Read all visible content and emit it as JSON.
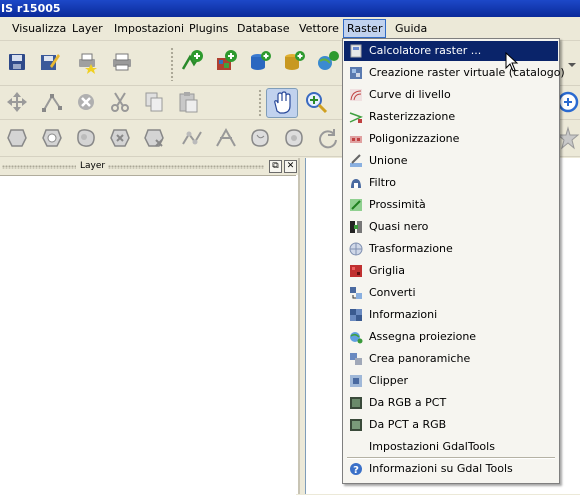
{
  "window": {
    "title": "IS r15005"
  },
  "menubar": {
    "items": [
      {
        "label": "Visualizza"
      },
      {
        "label": "Layer"
      },
      {
        "label": "Impostazioni"
      },
      {
        "label": "Plugins"
      },
      {
        "label": "Database"
      },
      {
        "label": "Vettore"
      },
      {
        "label": "Raster"
      },
      {
        "label": "Guida"
      }
    ]
  },
  "layers_panel": {
    "title": "Layer",
    "float_glyph": "⧉",
    "close_glyph": "✕"
  },
  "raster_menu": {
    "items": [
      {
        "label": "Calcolatore raster ...",
        "icon": "calculator-icon",
        "highlighted": true
      },
      {
        "label": "Creazione raster virtuale (catalogo)",
        "icon": "virtual-raster-icon"
      },
      {
        "label": "Curve di livello",
        "icon": "contour-icon"
      },
      {
        "label": "Rasterizzazione",
        "icon": "rasterize-icon"
      },
      {
        "label": "Poligonizzazione",
        "icon": "polygonize-icon"
      },
      {
        "label": "Unione",
        "icon": "merge-icon"
      },
      {
        "label": "Filtro",
        "icon": "sieve-icon"
      },
      {
        "label": "Prossimità",
        "icon": "proximity-icon"
      },
      {
        "label": "Quasi nero",
        "icon": "nearblack-icon"
      },
      {
        "label": "Trasformazione",
        "icon": "warp-icon"
      },
      {
        "label": "Griglia",
        "icon": "grid-icon"
      },
      {
        "label": "Converti",
        "icon": "translate-icon"
      },
      {
        "label": "Informazioni",
        "icon": "info-icon"
      },
      {
        "label": "Assegna proiezione",
        "icon": "projection-icon"
      },
      {
        "label": "Crea panoramiche",
        "icon": "overview-icon"
      },
      {
        "label": "Clipper",
        "icon": "clipper-icon"
      },
      {
        "label": "Da RGB a PCT",
        "icon": "rgb-to-pct-icon"
      },
      {
        "label": "Da PCT a RGB",
        "icon": "pct-to-rgb-icon"
      },
      {
        "label": "Impostazioni GdalTools",
        "icon": ""
      },
      {
        "label": "Informazioni su Gdal Tools",
        "icon": "help-icon"
      }
    ]
  },
  "colors": {
    "titlebar": "#0a2a9a",
    "menu_highlight": "#0a246a",
    "active_menu": "#c1d2ee",
    "toolbar_bg": "#ece9d8"
  }
}
